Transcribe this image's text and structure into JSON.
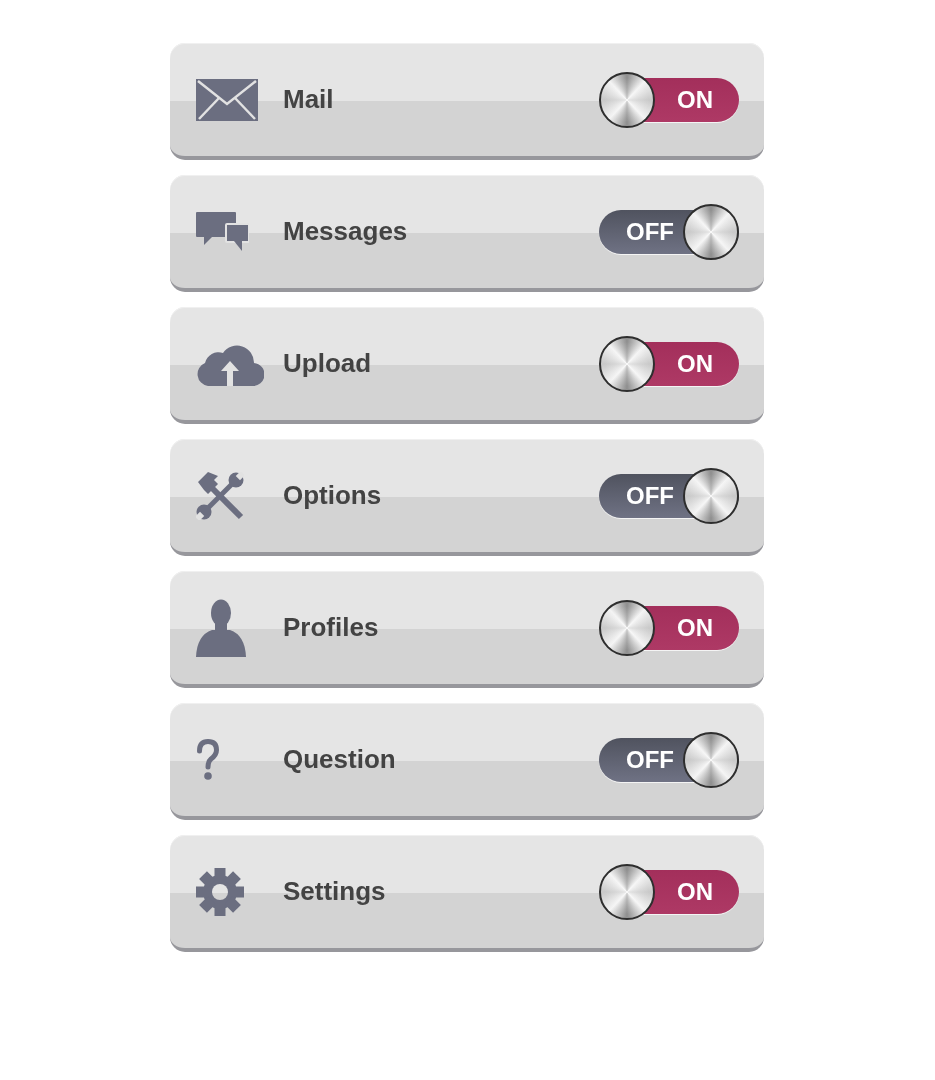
{
  "toggles": [
    {
      "kind": "mail",
      "label": "Mail",
      "on": true,
      "state_label": "ON"
    },
    {
      "kind": "messages",
      "label": "Messages",
      "on": false,
      "state_label": "OFF"
    },
    {
      "kind": "upload",
      "label": "Upload",
      "on": true,
      "state_label": "ON"
    },
    {
      "kind": "tools",
      "label": "Options",
      "on": false,
      "state_label": "OFF"
    },
    {
      "kind": "profile",
      "label": "Profiles",
      "on": true,
      "state_label": "ON"
    },
    {
      "kind": "question",
      "label": "Question",
      "on": false,
      "state_label": "OFF"
    },
    {
      "kind": "settings",
      "label": "Settings",
      "on": true,
      "state_label": "ON"
    }
  ]
}
